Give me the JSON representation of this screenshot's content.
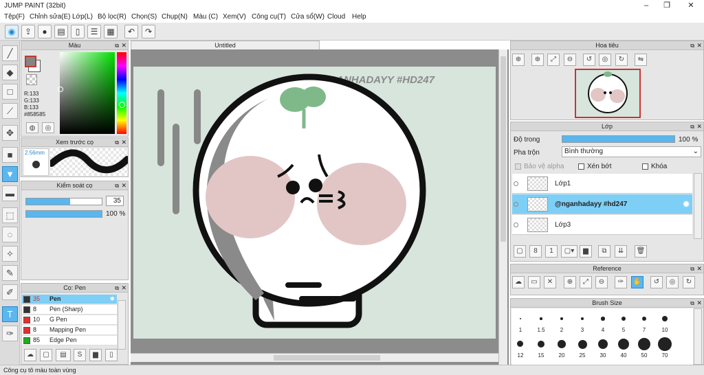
{
  "window": {
    "title": "JUMP PAINT (32bit)",
    "min": "–",
    "max": "❐",
    "close": "✕"
  },
  "menu": [
    "Tệp(F)",
    "Chỉnh sửa(E)",
    "Lớp(L)",
    "Bộ lọc(R)",
    "Chọn(S)",
    "Chụp(N)",
    "Màu (C)",
    "Xem(V)",
    "Công cụ(T)",
    "Cửa sổ(W)",
    "Cloud",
    "Help"
  ],
  "toolbar": {
    "icons": [
      "bucket-icon",
      "export-icon",
      "chat-icon",
      "comment-icon",
      "page-icon",
      "list-icon",
      "grid-icon",
      "undo-icon",
      "redo-icon"
    ]
  },
  "color_panel": {
    "title": "Màu",
    "r": "R:133",
    "g": "G:133",
    "b": "B:133",
    "hex": "#858585",
    "primary": "#858585",
    "secondary": "#ffffff"
  },
  "preview_panel": {
    "title": "Xem trước cọ",
    "size": "2.56mm"
  },
  "brush_control": {
    "title": "Kiểm soát cọ",
    "size_value": "35",
    "size_fraction": 0.58,
    "opacity_value": "100 %",
    "opacity_fraction": 1.0
  },
  "brush_panel": {
    "title": "Cọ: Pen",
    "items": [
      {
        "size": "35",
        "name": "Pen",
        "color": "#333333",
        "selected": true
      },
      {
        "size": "8",
        "name": "Pen (Sharp)",
        "color": "#333333",
        "selected": false
      },
      {
        "size": "10",
        "name": "G Pen",
        "color": "#e03030",
        "selected": false
      },
      {
        "size": "8",
        "name": "Mapping Pen",
        "color": "#e03030",
        "selected": false
      },
      {
        "size": "85",
        "name": "Edge Pen",
        "color": "#22aa22",
        "selected": false
      }
    ]
  },
  "document": {
    "tab": "Untitled",
    "watermark": "@NGANHADAYY #HD247"
  },
  "navigator": {
    "title": "Hoa tiêu"
  },
  "layer_panel": {
    "title": "Lớp",
    "opacity_label": "Độ trong",
    "opacity_value": "100 %",
    "opacity_fraction": 1.0,
    "blend_label": "Pha trộn",
    "blend_value": "Bình thường",
    "alpha_lock": "Bảo vệ alpha",
    "clip": "Xén bớt",
    "lock": "Khóa",
    "layers": [
      {
        "name": "Lớp1",
        "selected": false
      },
      {
        "name": "@nganhadayy #hd247",
        "selected": true
      },
      {
        "name": "Lớp3",
        "selected": false
      }
    ]
  },
  "reference_panel": {
    "title": "Reference"
  },
  "brush_size_panel": {
    "title": "Brush Size",
    "sizes": [
      "1",
      "1.5",
      "2",
      "3",
      "4",
      "5",
      "7",
      "10",
      "12",
      "15",
      "20",
      "25",
      "30",
      "40",
      "50",
      "70"
    ]
  },
  "status": {
    "text": "Công cụ tô màu toàn vùng"
  }
}
